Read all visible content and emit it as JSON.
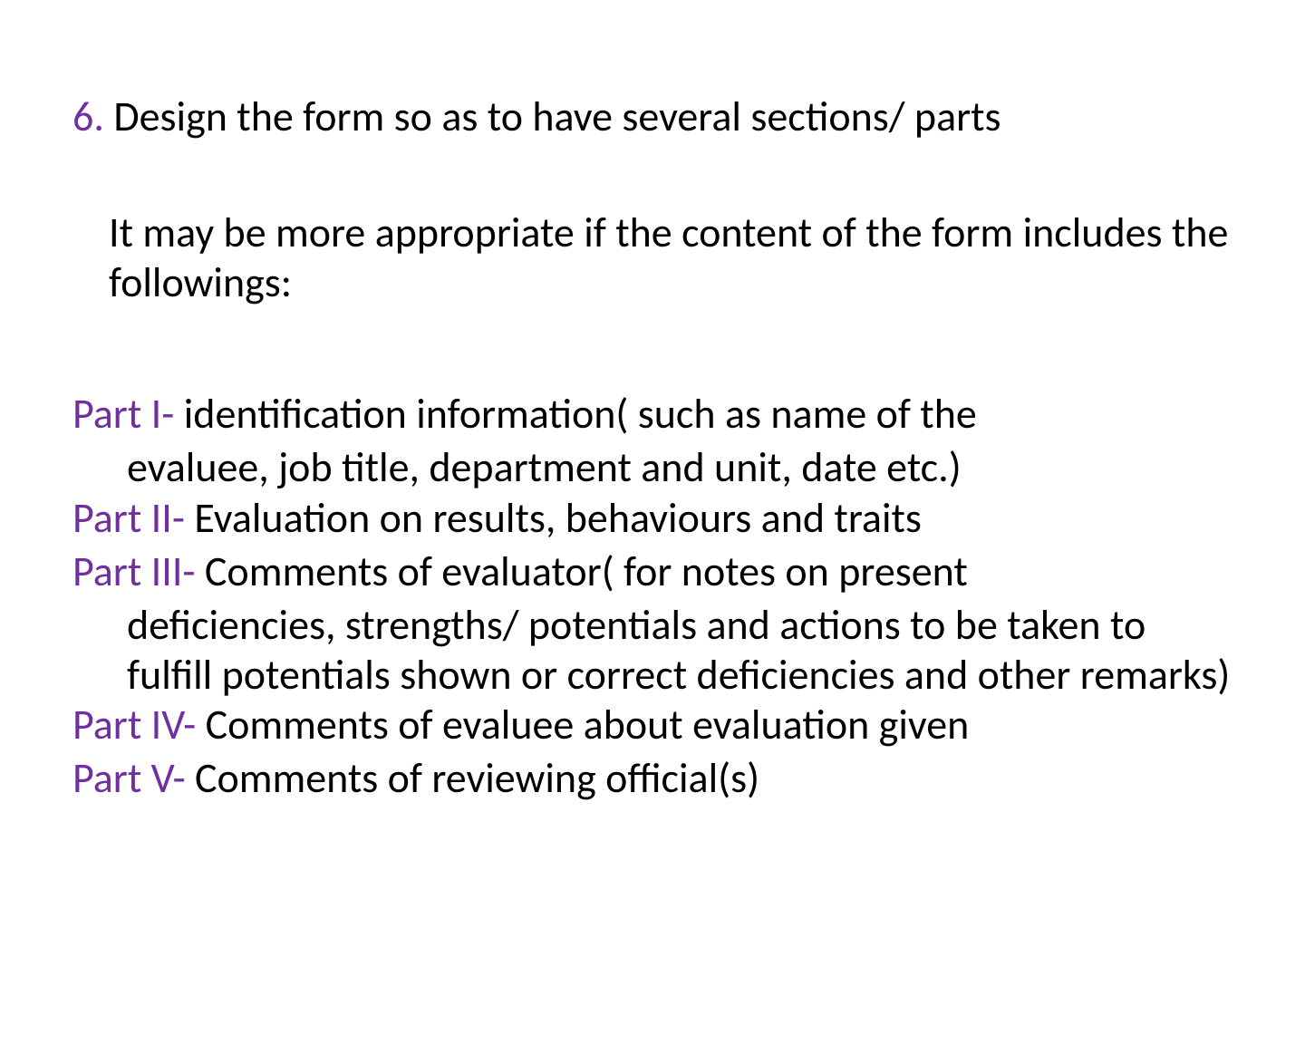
{
  "title": {
    "number": "6.",
    "text": " Design the form so as to have several sections/ parts"
  },
  "intro": "It may be more appropriate if the content of the form includes the followings:",
  "parts": [
    {
      "label": "Part I- ",
      "desc": "identification information( such as name of the",
      "continuation": "evaluee,  job title, department and unit, date etc.)"
    },
    {
      "label": "Part II- ",
      "desc": "Evaluation on results, behaviours and traits",
      "continuation": ""
    },
    {
      "label": "Part III- ",
      "desc": "Comments of evaluator( for notes on present",
      "continuation": "deficiencies, strengths/ potentials and actions to be taken to fulfill potentials shown or correct deficiencies and other remarks)"
    },
    {
      "label": "Part IV- ",
      "desc": "Comments of evaluee about  evaluation given",
      "continuation": ""
    },
    {
      "label": "Part V- ",
      "desc": "Comments of reviewing official(s)",
      "continuation": ""
    }
  ]
}
